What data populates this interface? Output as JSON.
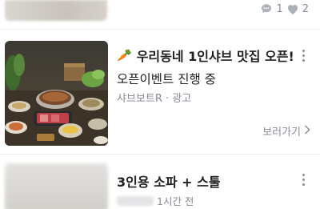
{
  "top_item": {
    "comment_count": "1",
    "like_count": "2"
  },
  "ad": {
    "emoji": "🥕",
    "title": "우리동네 1인샤브 맛집 오픈!",
    "subtitle": "오픈이벤트 진행 중",
    "advertiser": "샤브보트R",
    "separator": " · ",
    "ad_label": "광고",
    "view_more": "보러가기"
  },
  "listing": {
    "title": "3인용 소파 + 스툴",
    "time": "1시간 전"
  },
  "colors": {
    "text_primary": "#212124",
    "text_secondary": "#868b94",
    "carrot": "#ff7e36",
    "divider": "#eeeeee"
  }
}
